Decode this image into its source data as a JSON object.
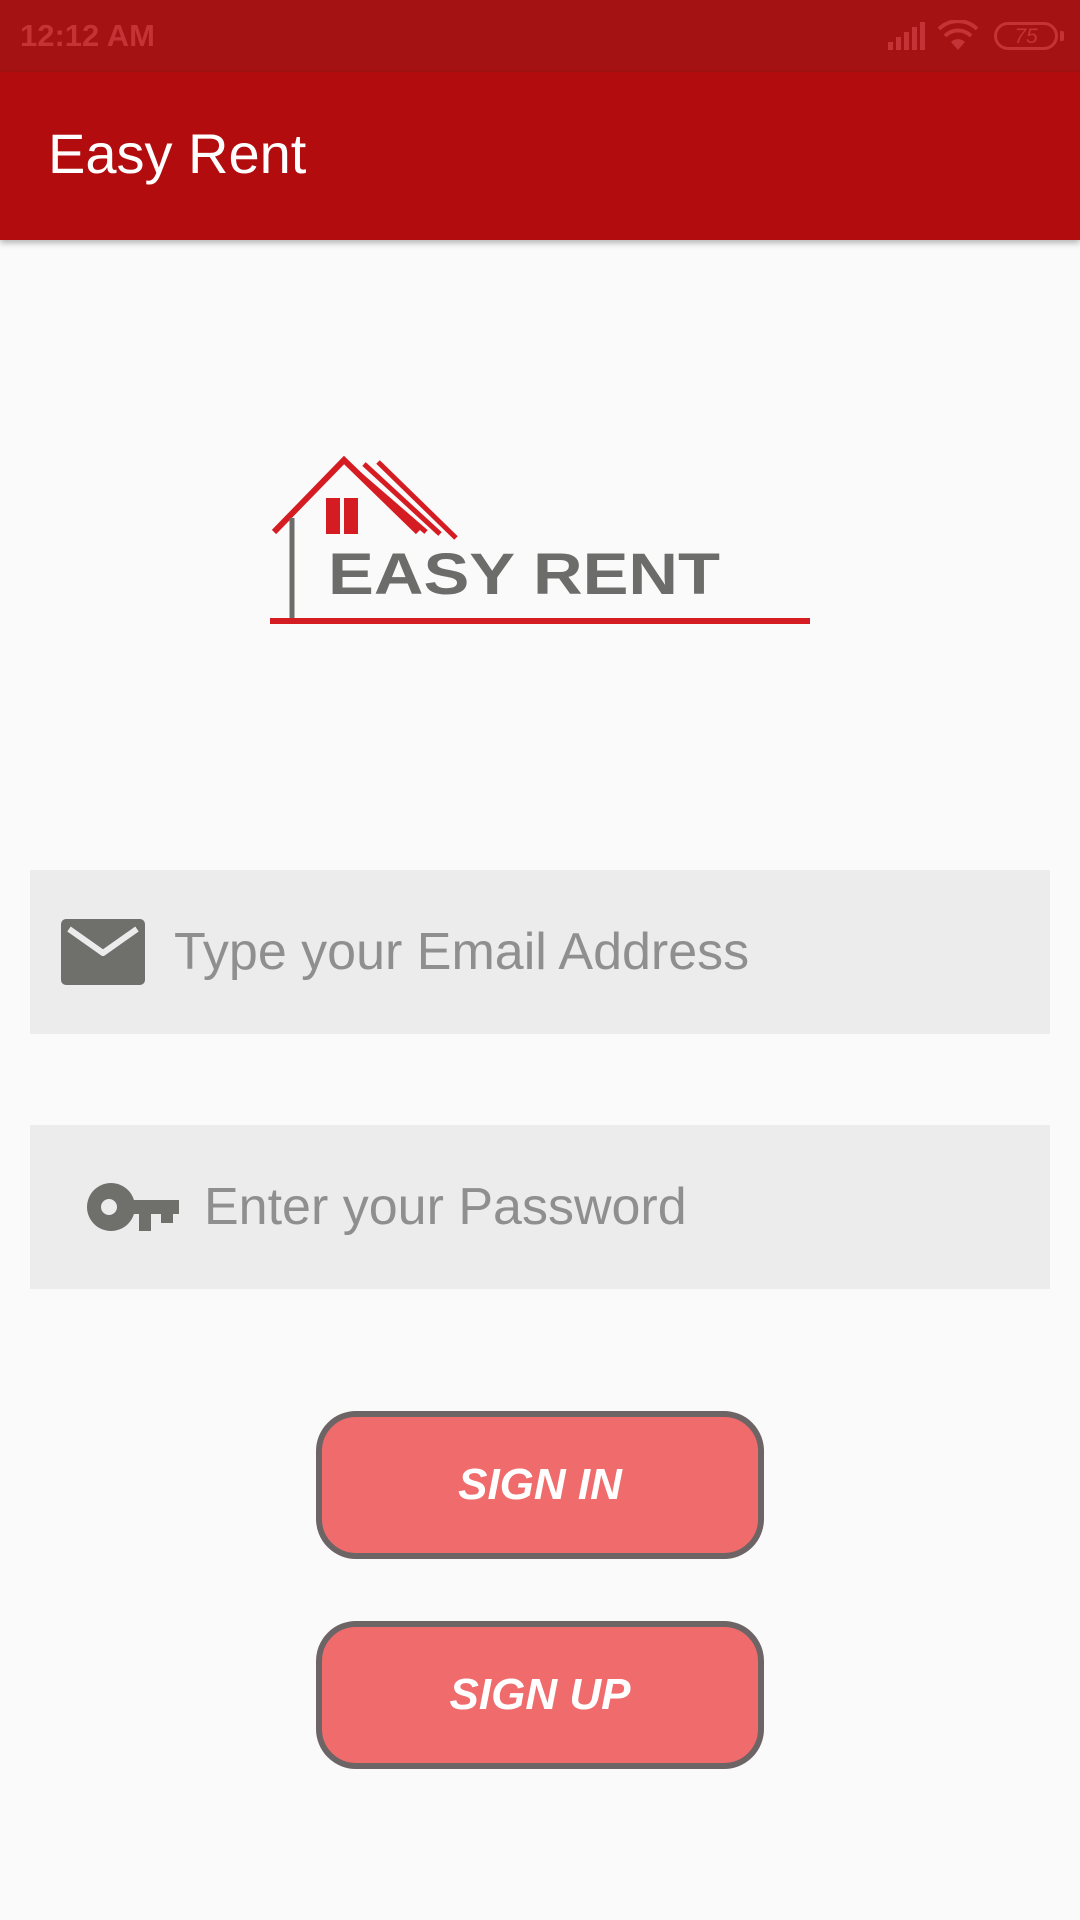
{
  "status_bar": {
    "time": "12:12 AM",
    "battery_level": "75",
    "icons": [
      "signal-icon",
      "wifi-icon",
      "battery-icon"
    ]
  },
  "app_bar": {
    "title": "Easy Rent"
  },
  "logo": {
    "text": "EASY RENT",
    "icon": "house-logo-icon"
  },
  "form": {
    "email": {
      "placeholder": "Type your Email Address",
      "value": "",
      "icon": "envelope-icon"
    },
    "password": {
      "placeholder": "Enter your Password",
      "value": "",
      "icon": "key-icon"
    }
  },
  "buttons": {
    "sign_in": "SIGN IN",
    "sign_up": "SIGN UP"
  },
  "colors": {
    "status_bar": "#a51213",
    "app_bar": "#b30c0e",
    "button_fill": "#f06c6c",
    "button_border": "#6d6565",
    "field_background": "#ececec",
    "icon_gray": "#6f706c"
  }
}
